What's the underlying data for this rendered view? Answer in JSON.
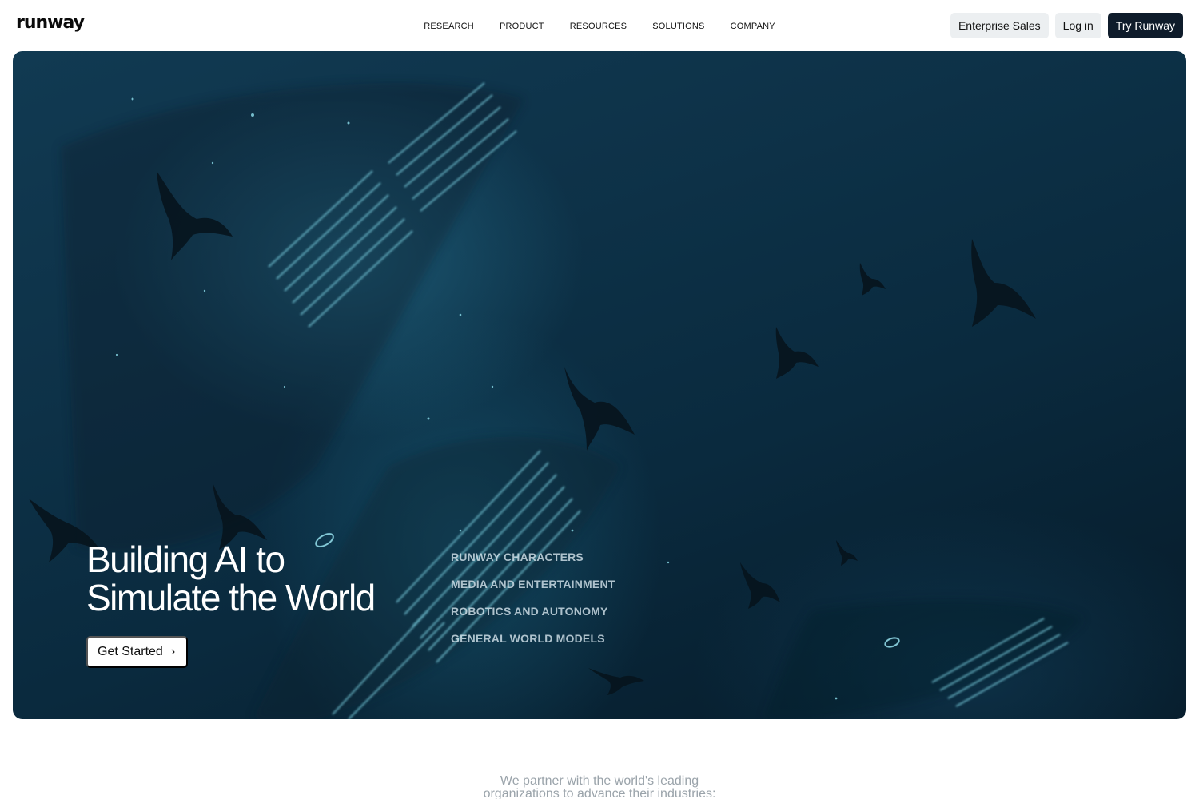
{
  "brand": {
    "logo": "runway"
  },
  "nav": {
    "items": [
      {
        "label": "RESEARCH"
      },
      {
        "label": "PRODUCT"
      },
      {
        "label": "RESOURCES"
      },
      {
        "label": "SOLUTIONS"
      },
      {
        "label": "COMPANY"
      }
    ]
  },
  "header_actions": {
    "enterprise_label": "Enterprise Sales",
    "login_label": "Log in",
    "try_label": "Try Runway"
  },
  "hero": {
    "title_line1": "Building AI to",
    "title_line2": "Simulate the World",
    "cta_label": "Get Started",
    "cta_icon": "chevron-right-icon",
    "links": [
      {
        "label": "RUNWAY CHARACTERS"
      },
      {
        "label": "MEDIA AND ENTERTAINMENT"
      },
      {
        "label": "ROBOTICS AND AUTONOMY"
      },
      {
        "label": "GENERAL WORLD MODELS"
      }
    ]
  },
  "partner_text_line1": "We partner with the world's leading",
  "partner_text_line2": "organizations to advance their industries:",
  "colors": {
    "hero_bg": "#0d3147",
    "primary_button": "#0f1c2b",
    "light_button": "#eceff1",
    "glow": "#7fd6e6"
  }
}
